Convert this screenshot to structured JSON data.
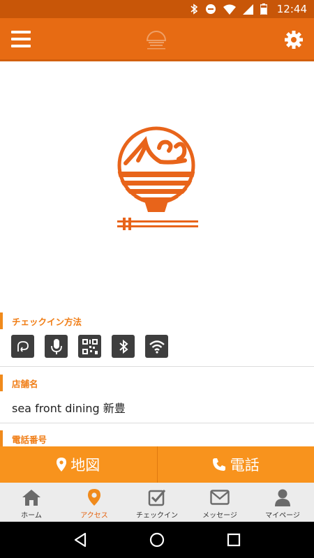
{
  "status_bar": {
    "time": "12:44"
  },
  "sections": {
    "checkin": {
      "title": "チェックイン方法"
    },
    "store": {
      "title": "店舗名",
      "value": "sea front dining 新豊"
    },
    "phone": {
      "title": "電話番号"
    }
  },
  "checkin_methods": [
    "touch-icon",
    "microphone-icon",
    "qr-code-icon",
    "bluetooth-icon",
    "wifi-icon"
  ],
  "actions": {
    "map_label": "地図",
    "call_label": "電話"
  },
  "bottom_nav": {
    "home": "ホーム",
    "access": "アクセス",
    "checkin": "チェックイン",
    "message": "メッセージ",
    "mypage": "マイページ",
    "active": "access"
  },
  "colors": {
    "primary": "#e76b13",
    "accent": "#f8931d",
    "section_title": "#f07d15"
  }
}
